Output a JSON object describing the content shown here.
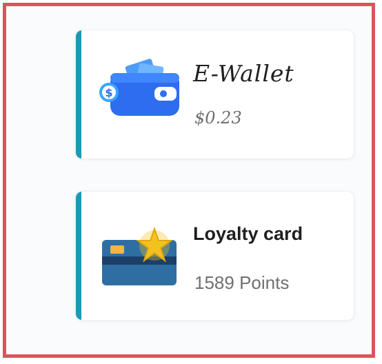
{
  "cards": [
    {
      "title": "E-Wallet",
      "value": "$0.23",
      "icon": "wallet-icon"
    },
    {
      "title": "Loyalty card",
      "value": "1589 Points",
      "icon": "loyalty-card-icon"
    }
  ],
  "colors": {
    "frame_border": "#d9555d",
    "card_accent": "#1a9ab4",
    "wallet_blue": "#2f6df0",
    "card_blue": "#2f6ea3",
    "star_yellow": "#f4c21f"
  }
}
